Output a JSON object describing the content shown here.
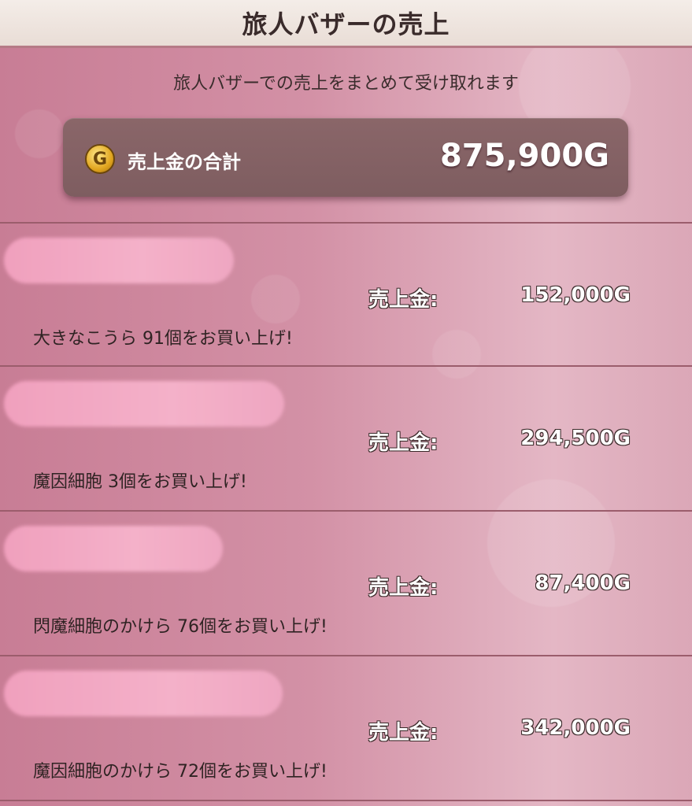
{
  "window": {
    "title": "旅人バザーの売上"
  },
  "subtitle": "旅人バザーでの売上をまとめて受け取れます",
  "total": {
    "icon": "gold-coin-icon",
    "coin_letter": "G",
    "label": "売上金の合計",
    "value": "875,900G"
  },
  "sales": [
    {
      "label": "売上金:",
      "amount": "152,000G",
      "description": "大きなこうら  91個をお買い上げ!"
    },
    {
      "label": "売上金:",
      "amount": "294,500G",
      "description": "魔因細胞  3個をお買い上げ!"
    },
    {
      "label": "売上金:",
      "amount": "87,400G",
      "description": "閃魔細胞のかけら  76個をお買い上げ!"
    },
    {
      "label": "売上金:",
      "amount": "342,000G",
      "description": "魔因細胞のかけら  72個をお買い上げ!"
    }
  ],
  "colors": {
    "accent_background": "#d391a6",
    "panel": "#7e5d60",
    "header": "#efe6e0"
  }
}
